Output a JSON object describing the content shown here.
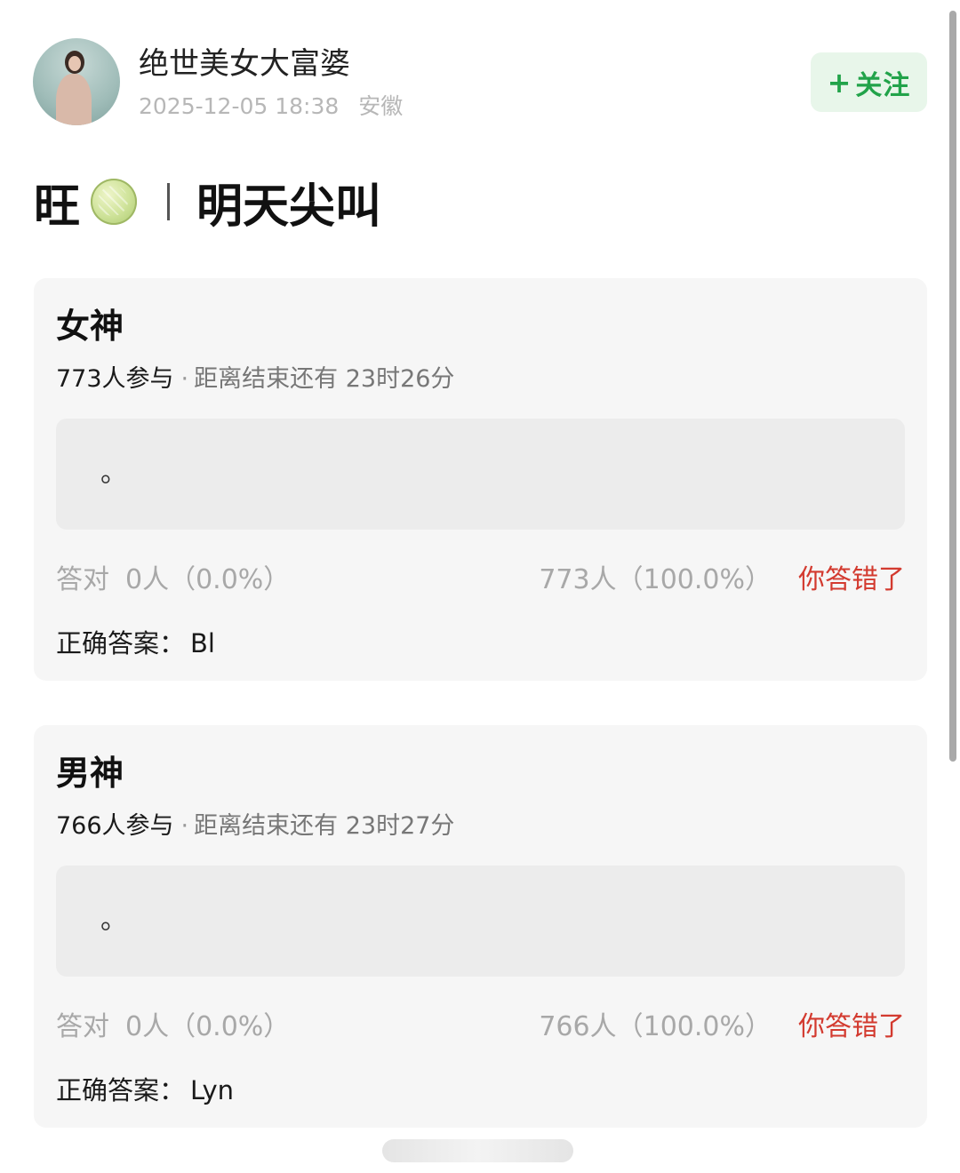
{
  "header": {
    "user_name": "绝世美女大富婆",
    "datetime": "2025-12-05 18:38",
    "location": "安徽",
    "follow": {
      "plus": "+",
      "label": "关注"
    }
  },
  "post": {
    "title_left": "旺",
    "title_right": "明天尖叫",
    "emoji": "melon"
  },
  "polls": [
    {
      "title": "女神",
      "participants": "773人参与",
      "separator": "·",
      "time_left": "距离结束还有 23时26分",
      "option_text": "。",
      "correct_label": "答对",
      "correct_value": "0人（0.0%）",
      "wrong_value": "773人（100.0%）",
      "status": "你答错了",
      "answer_label": "正确答案：",
      "answer_value": "Bl"
    },
    {
      "title": "男神",
      "participants": "766人参与",
      "separator": "·",
      "time_left": "距离结束还有 23时27分",
      "option_text": "。",
      "correct_label": "答对",
      "correct_value": "0人（0.0%）",
      "wrong_value": "766人（100.0%）",
      "status": "你答错了",
      "answer_label": "正确答案：",
      "answer_value": "Lyn"
    }
  ],
  "colors": {
    "follow_bg": "#e8f6ea",
    "follow_text": "#22a34a",
    "wrong": "#d33a2f",
    "card_bg": "#f6f6f6"
  }
}
